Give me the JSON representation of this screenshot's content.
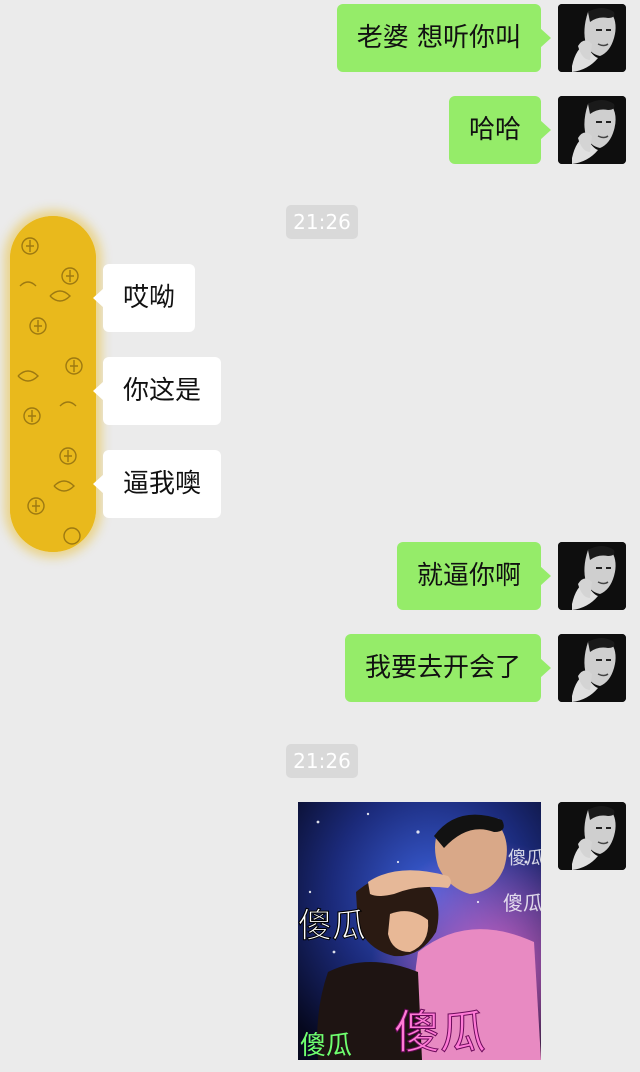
{
  "colors": {
    "background": "#ebebeb",
    "outgoing_bubble": "#95ec69",
    "incoming_bubble": "#ffffff",
    "timestamp_pill": "#d9d9d9"
  },
  "messages": [
    {
      "side": "right",
      "text": "老婆 想听你叫"
    },
    {
      "side": "right",
      "text": "哈哈"
    },
    {
      "timestamp": "21:26"
    },
    {
      "side": "left",
      "text": "哎呦"
    },
    {
      "side": "left",
      "text": "你这是"
    },
    {
      "side": "left",
      "text": "逼我噢"
    },
    {
      "side": "right",
      "text": "就逼你啊"
    },
    {
      "side": "right",
      "text": "我要去开会了"
    },
    {
      "timestamp": "21:26"
    },
    {
      "side": "right",
      "image": "couple-photo"
    }
  ],
  "photo": {
    "caption_large": "傻瓜",
    "caption_left": "傻瓜",
    "caption_bottom_left": "傻瓜",
    "caption_top_right": "傻瓜",
    "caption_mid_right": "傻瓜"
  },
  "icons": {
    "self_avatar": "man-portrait-avatar",
    "contact_avatar": "yellow-pattern-avatar"
  }
}
